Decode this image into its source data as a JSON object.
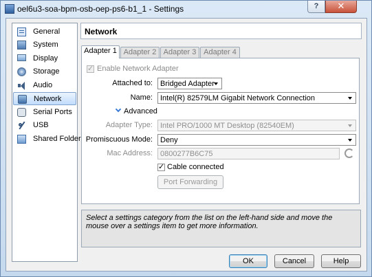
{
  "window": {
    "title": "oel6u3-soa-bpm-osb-oep-ps6-b1_1 - Settings",
    "help_button": "?",
    "close_button": "✕"
  },
  "sidebar": {
    "items": [
      {
        "label": "General",
        "icon": "general-icon"
      },
      {
        "label": "System",
        "icon": "system-icon"
      },
      {
        "label": "Display",
        "icon": "display-icon"
      },
      {
        "label": "Storage",
        "icon": "storage-icon"
      },
      {
        "label": "Audio",
        "icon": "audio-icon"
      },
      {
        "label": "Network",
        "icon": "network-icon",
        "selected": true
      },
      {
        "label": "Serial Ports",
        "icon": "serial-port-icon"
      },
      {
        "label": "USB",
        "icon": "usb-icon"
      },
      {
        "label": "Shared Folders",
        "icon": "shared-folder-icon"
      }
    ]
  },
  "header": {
    "title": "Network"
  },
  "tabs": [
    {
      "label": "Adapter 1",
      "active": true
    },
    {
      "label": "Adapter 2",
      "active": false
    },
    {
      "label": "Adapter 3",
      "active": false
    },
    {
      "label": "Adapter 4",
      "active": false
    }
  ],
  "adapter": {
    "enable_label": "Enable Network Adapter",
    "enabled": true,
    "attached_label": "Attached to:",
    "attached_value": "Bridged Adapter",
    "name_label": "Name:",
    "name_value": "Intel(R) 82579LM Gigabit Network Connection",
    "advanced_label": "Advanced",
    "adapter_type_label": "Adapter Type:",
    "adapter_type_value": "Intel PRO/1000 MT Desktop (82540EM)",
    "promiscuous_label": "Promiscuous Mode:",
    "promiscuous_value": "Deny",
    "mac_label": "Mac Address:",
    "mac_value": "0800277B6C75",
    "cable_label": "Cable connected",
    "cable_connected": true,
    "port_forwarding_label": "Port Forwarding"
  },
  "info": {
    "text": "Select a settings category from the list on the left-hand side and move the mouse over a settings item to get more information."
  },
  "buttons": {
    "ok": "OK",
    "cancel": "Cancel",
    "help": "Help"
  },
  "colors": {
    "selection": "#c1dcfc",
    "titlebar": "#c5d9ee",
    "close": "#c8523a"
  }
}
